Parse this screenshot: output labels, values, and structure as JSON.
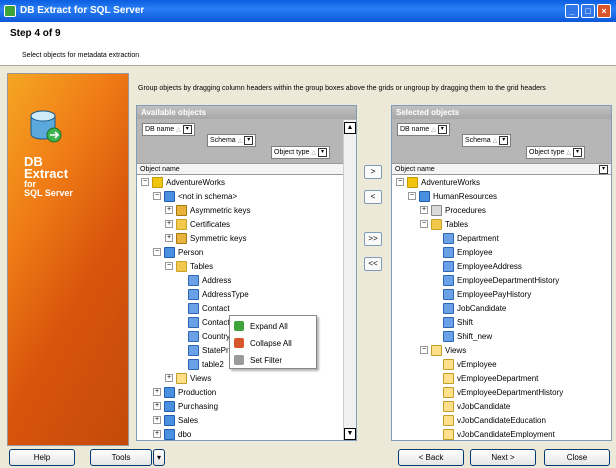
{
  "window": {
    "title": "DB Extract  for SQL Server",
    "min": "_",
    "max": "□",
    "close": "×"
  },
  "header": {
    "step": "Step 4 of 9",
    "subtitle": "Select objects for metadata extraction"
  },
  "brand": {
    "line1": "DB",
    "line2": "Extract",
    "line3": "for",
    "line4": "SQL Server"
  },
  "hint": "Group objects by dragging column headers within the group boxes above the grids or ungroup by dragging them to the grid headers",
  "available": {
    "title": "Available objects",
    "group_fields": [
      "DB name",
      "Schema",
      "Object type"
    ],
    "column": "Object name",
    "rows": [
      {
        "label": "AdventureWorks",
        "indent": 0,
        "icon": "database",
        "toggle": "−"
      },
      {
        "label": "<not in schema>",
        "indent": 1,
        "icon": "schema",
        "toggle": "−"
      },
      {
        "label": "Asymmetric keys",
        "indent": 2,
        "icon": "key",
        "toggle": "+"
      },
      {
        "label": "Certificates",
        "indent": 2,
        "icon": "folder",
        "toggle": "+"
      },
      {
        "label": "Symmetric keys",
        "indent": 2,
        "icon": "key",
        "toggle": "+"
      },
      {
        "label": "Person",
        "indent": 1,
        "icon": "schema",
        "toggle": "−"
      },
      {
        "label": "Tables",
        "indent": 2,
        "icon": "folder",
        "toggle": "−"
      },
      {
        "label": "Address",
        "indent": 3,
        "icon": "table",
        "toggle": ""
      },
      {
        "label": "AddressType",
        "indent": 3,
        "icon": "table",
        "toggle": ""
      },
      {
        "label": "Contact",
        "indent": 3,
        "icon": "table",
        "toggle": ""
      },
      {
        "label": "ContactTy",
        "indent": 3,
        "icon": "table",
        "toggle": ""
      },
      {
        "label": "CountryRe",
        "indent": 3,
        "icon": "table",
        "toggle": ""
      },
      {
        "label": "StateProvi",
        "indent": 3,
        "icon": "table",
        "toggle": ""
      },
      {
        "label": "table2",
        "indent": 3,
        "icon": "table",
        "toggle": ""
      },
      {
        "label": "Views",
        "indent": 2,
        "icon": "view",
        "toggle": "+"
      },
      {
        "label": "Production",
        "indent": 1,
        "icon": "schema",
        "toggle": "+"
      },
      {
        "label": "Purchasing",
        "indent": 1,
        "icon": "schema",
        "toggle": "+"
      },
      {
        "label": "Sales",
        "indent": 1,
        "icon": "schema",
        "toggle": "+"
      },
      {
        "label": "dbo",
        "indent": 1,
        "icon": "schema",
        "toggle": "+"
      }
    ]
  },
  "selected": {
    "title": "Selected objects",
    "group_fields": [
      "DB name",
      "Schema",
      "Object type"
    ],
    "column": "Object name",
    "rows": [
      {
        "label": "AdventureWorks",
        "indent": 0,
        "icon": "database",
        "toggle": "−"
      },
      {
        "label": "HumanResources",
        "indent": 1,
        "icon": "schema",
        "toggle": "−"
      },
      {
        "label": "Procedures",
        "indent": 2,
        "icon": "procedure",
        "toggle": "+"
      },
      {
        "label": "Tables",
        "indent": 2,
        "icon": "folder",
        "toggle": "−"
      },
      {
        "label": "Department",
        "indent": 3,
        "icon": "table",
        "toggle": ""
      },
      {
        "label": "Employee",
        "indent": 3,
        "icon": "table",
        "toggle": ""
      },
      {
        "label": "EmployeeAddress",
        "indent": 3,
        "icon": "table",
        "toggle": ""
      },
      {
        "label": "EmployeeDepartmentHistory",
        "indent": 3,
        "icon": "table",
        "toggle": ""
      },
      {
        "label": "EmployeePayHistory",
        "indent": 3,
        "icon": "table",
        "toggle": ""
      },
      {
        "label": "JobCandidate",
        "indent": 3,
        "icon": "table",
        "toggle": ""
      },
      {
        "label": "Shift",
        "indent": 3,
        "icon": "table",
        "toggle": ""
      },
      {
        "label": "Shift_new",
        "indent": 3,
        "icon": "table",
        "toggle": ""
      },
      {
        "label": "Views",
        "indent": 2,
        "icon": "view",
        "toggle": "−"
      },
      {
        "label": "vEmployee",
        "indent": 3,
        "icon": "view",
        "toggle": ""
      },
      {
        "label": "vEmployeeDepartment",
        "indent": 3,
        "icon": "view",
        "toggle": ""
      },
      {
        "label": "vEmployeeDepartmentHistory",
        "indent": 3,
        "icon": "view",
        "toggle": ""
      },
      {
        "label": "vJobCandidate",
        "indent": 3,
        "icon": "view",
        "toggle": ""
      },
      {
        "label": "vJobCandidateEducation",
        "indent": 3,
        "icon": "view",
        "toggle": ""
      },
      {
        "label": "vJobCandidateEmployment",
        "indent": 3,
        "icon": "view",
        "toggle": ""
      }
    ]
  },
  "transfer": {
    "add": ">",
    "remove": "<",
    "add_all": ">>",
    "remove_all": "<<"
  },
  "context_menu": {
    "items": [
      "Expand All",
      "Collapse All",
      "Set Filter"
    ]
  },
  "footer": {
    "help": "Help",
    "tools": "Tools",
    "back": "< Back",
    "next": "Next >",
    "close": "Close"
  }
}
